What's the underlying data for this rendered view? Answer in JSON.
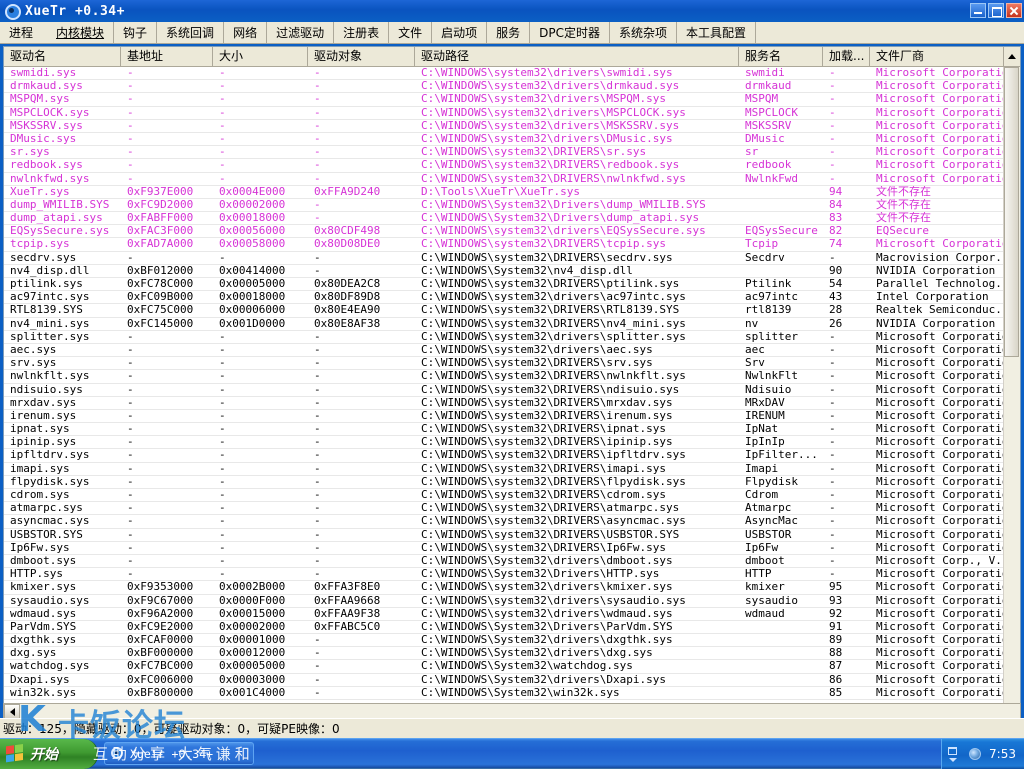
{
  "window": {
    "title": "XueTr  +0.34+",
    "icon": "shield-icon",
    "minimize_label": "",
    "maximize_label": "",
    "close_label": ""
  },
  "menu": {
    "items": [
      {
        "label": "进程",
        "selected": false
      },
      {
        "label": "内核模块",
        "selected": true
      },
      {
        "label": "钩子",
        "selected": false
      },
      {
        "label": "系统回调",
        "selected": false
      },
      {
        "label": "网络",
        "selected": false
      },
      {
        "label": "过滤驱动",
        "selected": false
      },
      {
        "label": "注册表",
        "selected": false
      },
      {
        "label": "文件",
        "selected": false
      },
      {
        "label": "启动项",
        "selected": false
      },
      {
        "label": "服务",
        "selected": false
      },
      {
        "label": "DPC定时器",
        "selected": false
      },
      {
        "label": "系统杂项",
        "selected": false
      },
      {
        "label": "本工具配置",
        "selected": false
      }
    ]
  },
  "table": {
    "columns": [
      "驱动名",
      "基地址",
      "大小",
      "驱动对象",
      "驱动路径",
      "服务名",
      "加载...",
      "文件厂商"
    ],
    "rows": [
      {
        "color": "pink",
        "cells": [
          "swmidi.sys",
          "-",
          "-",
          "-",
          "C:\\WINDOWS\\system32\\drivers\\swmidi.sys",
          "swmidi",
          "-",
          "Microsoft Corporatio"
        ]
      },
      {
        "color": "pink",
        "cells": [
          "drmkaud.sys",
          "-",
          "-",
          "-",
          "C:\\WINDOWS\\system32\\drivers\\drmkaud.sys",
          "drmkaud",
          "-",
          "Microsoft Corporatio"
        ]
      },
      {
        "color": "pink",
        "cells": [
          "MSPQM.sys",
          "-",
          "-",
          "-",
          "C:\\WINDOWS\\system32\\drivers\\MSPQM.sys",
          "MSPQM",
          "-",
          "Microsoft Corporatio"
        ]
      },
      {
        "color": "pink",
        "cells": [
          "MSPCLOCK.sys",
          "-",
          "-",
          "-",
          "C:\\WINDOWS\\system32\\drivers\\MSPCLOCK.sys",
          "MSPCLOCK",
          "-",
          "Microsoft Corporatio"
        ]
      },
      {
        "color": "pink",
        "cells": [
          "MSKSSRV.sys",
          "-",
          "-",
          "-",
          "C:\\WINDOWS\\system32\\drivers\\MSKSSRV.sys",
          "MSKSSRV",
          "-",
          "Microsoft Corporatio"
        ]
      },
      {
        "color": "pink",
        "cells": [
          "DMusic.sys",
          "-",
          "-",
          "-",
          "C:\\WINDOWS\\system32\\drivers\\DMusic.sys",
          "DMusic",
          "-",
          "Microsoft Corporatio"
        ]
      },
      {
        "color": "pink",
        "cells": [
          "sr.sys",
          "-",
          "-",
          "-",
          "C:\\WINDOWS\\system32\\DRIVERS\\sr.sys",
          "sr",
          "-",
          "Microsoft Corporatio"
        ]
      },
      {
        "color": "pink",
        "cells": [
          "redbook.sys",
          "-",
          "-",
          "-",
          "C:\\WINDOWS\\system32\\DRIVERS\\redbook.sys",
          "redbook",
          "-",
          "Microsoft Corporatio"
        ]
      },
      {
        "color": "pink",
        "cells": [
          "nwlnkfwd.sys",
          "-",
          "-",
          "-",
          "C:\\WINDOWS\\system32\\DRIVERS\\nwlnkfwd.sys",
          "NwlnkFwd",
          "-",
          "Microsoft Corporatio"
        ]
      },
      {
        "color": "pink",
        "cells": [
          "XueTr.sys",
          "0xF937E000",
          "0x0004E000",
          "0xFFA9D240",
          "D:\\Tools\\XueTr\\XueTr.sys",
          "",
          "94",
          "文件不存在"
        ]
      },
      {
        "color": "pink",
        "cells": [
          "dump_WMILIB.SYS",
          "0xFC9D2000",
          "0x00002000",
          "-",
          "C:\\WINDOWS\\System32\\Drivers\\dump_WMILIB.SYS",
          "",
          "84",
          "文件不存在"
        ]
      },
      {
        "color": "pink",
        "cells": [
          "dump_atapi.sys",
          "0xFABFF000",
          "0x00018000",
          "-",
          "C:\\WINDOWS\\System32\\Drivers\\dump_atapi.sys",
          "",
          "83",
          "文件不存在"
        ]
      },
      {
        "color": "pink",
        "cells": [
          "EQSysSecure.sys",
          "0xFAC3F000",
          "0x00056000",
          "0x80CDF498",
          "C:\\WINDOWS\\system32\\drivers\\EQSysSecure.sys",
          "EQSysSecure",
          "82",
          "EQSecure"
        ]
      },
      {
        "color": "pink",
        "cells": [
          "tcpip.sys",
          "0xFAD7A000",
          "0x00058000",
          "0x80D08DE0",
          "C:\\WINDOWS\\system32\\DRIVERS\\tcpip.sys",
          "Tcpip",
          "74",
          "Microsoft Corporatio"
        ]
      },
      {
        "color": "dark",
        "cells": [
          "secdrv.sys",
          "-",
          "-",
          "-",
          "C:\\WINDOWS\\system32\\DRIVERS\\secdrv.sys",
          "Secdrv",
          "-",
          "Macrovision Corpor.."
        ]
      },
      {
        "color": "dark",
        "cells": [
          "nv4_disp.dll",
          "0xBF012000",
          "0x00414000",
          "-",
          "C:\\WINDOWS\\System32\\nv4_disp.dll",
          "",
          "90",
          "NVIDIA Corporation"
        ]
      },
      {
        "color": "dark",
        "cells": [
          "ptilink.sys",
          "0xFC78C000",
          "0x00005000",
          "0x80DEA2C8",
          "C:\\WINDOWS\\system32\\DRIVERS\\ptilink.sys",
          "Ptilink",
          "54",
          "Parallel Technolog.."
        ]
      },
      {
        "color": "dark",
        "cells": [
          "ac97intc.sys",
          "0xFC09B000",
          "0x00018000",
          "0x80DF89D8",
          "C:\\WINDOWS\\system32\\drivers\\ac97intc.sys",
          "ac97intc",
          "43",
          "Intel Corporation"
        ]
      },
      {
        "color": "dark",
        "cells": [
          "RTL8139.SYS",
          "0xFC75C000",
          "0x00006000",
          "0x80E4EA90",
          "C:\\WINDOWS\\system32\\DRIVERS\\RTL8139.SYS",
          "rtl8139",
          "28",
          "Realtek Semiconduc.."
        ]
      },
      {
        "color": "dark",
        "cells": [
          "nv4_mini.sys",
          "0xFC145000",
          "0x001D0000",
          "0x80E8AF38",
          "C:\\WINDOWS\\system32\\DRIVERS\\nv4_mini.sys",
          "nv",
          "26",
          "NVIDIA Corporation"
        ]
      },
      {
        "color": "dark",
        "cells": [
          "splitter.sys",
          "-",
          "-",
          "-",
          "C:\\WINDOWS\\system32\\drivers\\splitter.sys",
          "splitter",
          "-",
          "Microsoft Corporatio"
        ]
      },
      {
        "color": "dark",
        "cells": [
          "aec.sys",
          "-",
          "-",
          "-",
          "C:\\WINDOWS\\system32\\drivers\\aec.sys",
          "aec",
          "-",
          "Microsoft Corporatio"
        ]
      },
      {
        "color": "dark",
        "cells": [
          "srv.sys",
          "-",
          "-",
          "-",
          "C:\\WINDOWS\\system32\\DRIVERS\\srv.sys",
          "Srv",
          "-",
          "Microsoft Corporatio"
        ]
      },
      {
        "color": "dark",
        "cells": [
          "nwlnkflt.sys",
          "-",
          "-",
          "-",
          "C:\\WINDOWS\\system32\\DRIVERS\\nwlnkflt.sys",
          "NwlnkFlt",
          "-",
          "Microsoft Corporatio"
        ]
      },
      {
        "color": "dark",
        "cells": [
          "ndisuio.sys",
          "-",
          "-",
          "-",
          "C:\\WINDOWS\\system32\\DRIVERS\\ndisuio.sys",
          "Ndisuio",
          "-",
          "Microsoft Corporatio"
        ]
      },
      {
        "color": "dark",
        "cells": [
          "mrxdav.sys",
          "-",
          "-",
          "-",
          "C:\\WINDOWS\\system32\\DRIVERS\\mrxdav.sys",
          "MRxDAV",
          "-",
          "Microsoft Corporatio"
        ]
      },
      {
        "color": "dark",
        "cells": [
          "irenum.sys",
          "-",
          "-",
          "-",
          "C:\\WINDOWS\\system32\\DRIVERS\\irenum.sys",
          "IRENUM",
          "-",
          "Microsoft Corporatio"
        ]
      },
      {
        "color": "dark",
        "cells": [
          "ipnat.sys",
          "-",
          "-",
          "-",
          "C:\\WINDOWS\\system32\\DRIVERS\\ipnat.sys",
          "IpNat",
          "-",
          "Microsoft Corporatio"
        ]
      },
      {
        "color": "dark",
        "cells": [
          "ipinip.sys",
          "-",
          "-",
          "-",
          "C:\\WINDOWS\\system32\\DRIVERS\\ipinip.sys",
          "IpInIp",
          "-",
          "Microsoft Corporatio"
        ]
      },
      {
        "color": "dark",
        "cells": [
          "ipfltdrv.sys",
          "-",
          "-",
          "-",
          "C:\\WINDOWS\\system32\\DRIVERS\\ipfltdrv.sys",
          "IpFilter...",
          "-",
          "Microsoft Corporatio"
        ]
      },
      {
        "color": "dark",
        "cells": [
          "imapi.sys",
          "-",
          "-",
          "-",
          "C:\\WINDOWS\\system32\\DRIVERS\\imapi.sys",
          "Imapi",
          "-",
          "Microsoft Corporatio"
        ]
      },
      {
        "color": "dark",
        "cells": [
          "flpydisk.sys",
          "-",
          "-",
          "-",
          "C:\\WINDOWS\\system32\\DRIVERS\\flpydisk.sys",
          "Flpydisk",
          "-",
          "Microsoft Corporatio"
        ]
      },
      {
        "color": "dark",
        "cells": [
          "cdrom.sys",
          "-",
          "-",
          "-",
          "C:\\WINDOWS\\system32\\DRIVERS\\cdrom.sys",
          "Cdrom",
          "-",
          "Microsoft Corporatio"
        ]
      },
      {
        "color": "dark",
        "cells": [
          "atmarpc.sys",
          "-",
          "-",
          "-",
          "C:\\WINDOWS\\system32\\DRIVERS\\atmarpc.sys",
          "Atmarpc",
          "-",
          "Microsoft Corporatio"
        ]
      },
      {
        "color": "dark",
        "cells": [
          "asyncmac.sys",
          "-",
          "-",
          "-",
          "C:\\WINDOWS\\system32\\DRIVERS\\asyncmac.sys",
          "AsyncMac",
          "-",
          "Microsoft Corporatio"
        ]
      },
      {
        "color": "dark",
        "cells": [
          "USBSTOR.SYS",
          "-",
          "-",
          "-",
          "C:\\WINDOWS\\system32\\DRIVERS\\USBSTOR.SYS",
          "USBSTOR",
          "-",
          "Microsoft Corporatio"
        ]
      },
      {
        "color": "dark",
        "cells": [
          "Ip6Fw.sys",
          "-",
          "-",
          "-",
          "C:\\WINDOWS\\system32\\DRIVERS\\Ip6Fw.sys",
          "Ip6Fw",
          "-",
          "Microsoft Corporatio"
        ]
      },
      {
        "color": "dark",
        "cells": [
          "dmboot.sys",
          "-",
          "-",
          "-",
          "C:\\WINDOWS\\System32\\drivers\\dmboot.sys",
          "dmboot",
          "-",
          "Microsoft Corp., V.."
        ]
      },
      {
        "color": "dark",
        "cells": [
          "HTTP.sys",
          "-",
          "-",
          "-",
          "C:\\WINDOWS\\System32\\Drivers\\HTTP.sys",
          "HTTP",
          "-",
          "Microsoft Corporatio"
        ]
      },
      {
        "color": "dark",
        "cells": [
          "kmixer.sys",
          "0xF9353000",
          "0x0002B000",
          "0xFFA3F8E0",
          "C:\\WINDOWS\\system32\\drivers\\kmixer.sys",
          "kmixer",
          "95",
          "Microsoft Corporatio"
        ]
      },
      {
        "color": "dark",
        "cells": [
          "sysaudio.sys",
          "0xF9C67000",
          "0x0000F000",
          "0xFFAA9668",
          "C:\\WINDOWS\\system32\\drivers\\sysaudio.sys",
          "sysaudio",
          "93",
          "Microsoft Corporatio"
        ]
      },
      {
        "color": "dark",
        "cells": [
          "wdmaud.sys",
          "0xF96A2000",
          "0x00015000",
          "0xFFAA9F38",
          "C:\\WINDOWS\\system32\\drivers\\wdmaud.sys",
          "wdmaud",
          "92",
          "Microsoft Corporatio"
        ]
      },
      {
        "color": "dark",
        "cells": [
          "ParVdm.SYS",
          "0xFC9E2000",
          "0x00002000",
          "0xFFABC5C0",
          "C:\\WINDOWS\\System32\\Drivers\\ParVdm.SYS",
          "",
          "91",
          "Microsoft Corporatio"
        ]
      },
      {
        "color": "dark",
        "cells": [
          "dxgthk.sys",
          "0xFCAF0000",
          "0x00001000",
          "-",
          "C:\\WINDOWS\\System32\\drivers\\dxgthk.sys",
          "",
          "89",
          "Microsoft Corporatio"
        ]
      },
      {
        "color": "dark",
        "cells": [
          "dxg.sys",
          "0xBF000000",
          "0x00012000",
          "-",
          "C:\\WINDOWS\\System32\\drivers\\dxg.sys",
          "",
          "88",
          "Microsoft Corporatio"
        ]
      },
      {
        "color": "dark",
        "cells": [
          "watchdog.sys",
          "0xFC7BC000",
          "0x00005000",
          "-",
          "C:\\WINDOWS\\System32\\watchdog.sys",
          "",
          "87",
          "Microsoft Corporatio"
        ]
      },
      {
        "color": "dark",
        "cells": [
          "Dxapi.sys",
          "0xFC006000",
          "0x00003000",
          "-",
          "C:\\WINDOWS\\System32\\drivers\\Dxapi.sys",
          "",
          "86",
          "Microsoft Corporatio"
        ]
      },
      {
        "color": "dark",
        "cells": [
          "win32k.sys",
          "0xBF800000",
          "0x001C4000",
          "-",
          "C:\\WINDOWS\\System32\\win32k.sys",
          "",
          "85",
          "Microsoft Corporatio"
        ]
      }
    ]
  },
  "scrollbars": {
    "up_arrow": "scroll-up-arrow",
    "left_arrow": "scroll-left-arrow"
  },
  "statusbar": {
    "text": "驱动：125，隐藏驱动：0，可疑驱动对象：0，可疑PE映像：0"
  },
  "watermark": {
    "letter": "K",
    "logo_text": "卡饭论坛",
    "subtitle": "互助分享 大气谦和"
  },
  "taskbar": {
    "start_label": "开始",
    "task_label": "XueTr +0.34+",
    "clock": "7:53"
  },
  "colors": {
    "title_bar": "#0b5fc4",
    "pink_rows": "#d633d6",
    "dark_rows": "#000000",
    "chrome": "#ece9d8",
    "watermark_blue": "#1b7fd4"
  }
}
